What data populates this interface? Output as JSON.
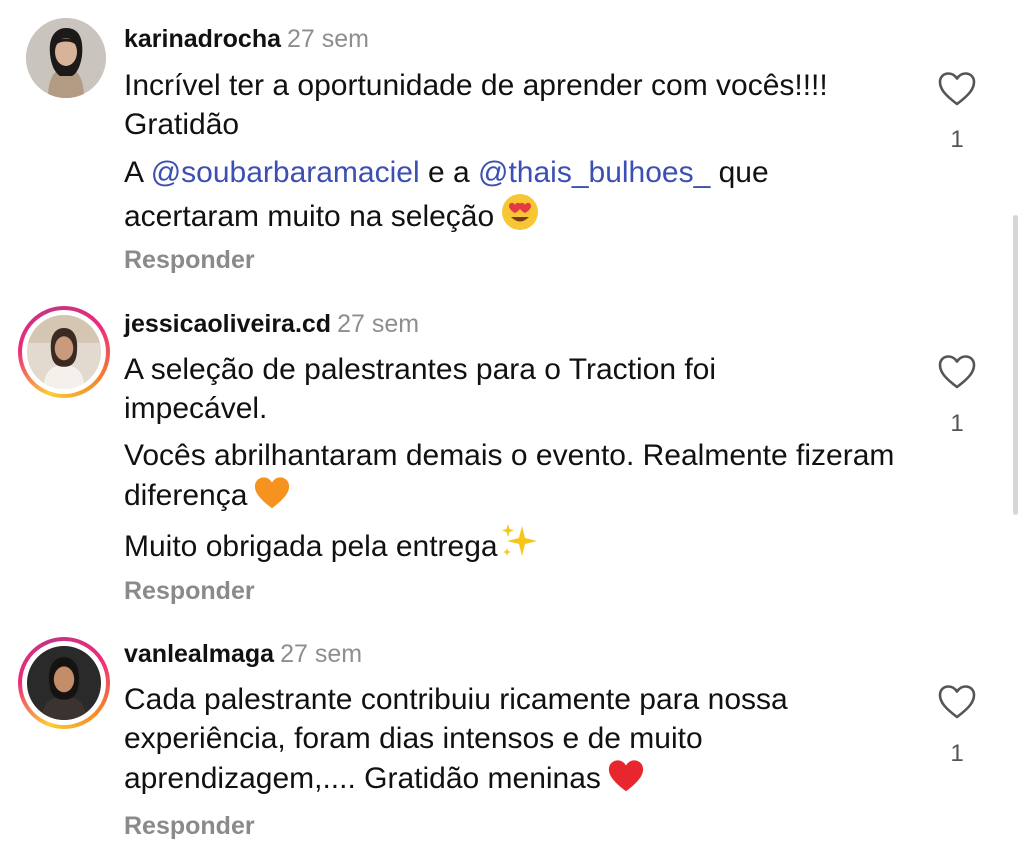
{
  "comments": [
    {
      "username": "karinadrocha",
      "time": "27 sem",
      "text": "Incrível ter a oportunidade de aprender com vocês!!!! Gratidão",
      "text2_pre": "A ",
      "mention1": "@soubarbaramaciel",
      "text2_mid": " e a ",
      "mention2": "@thais_bulhoes_",
      "text2_post": " que acertaram muito na seleção",
      "emoji": "heart-eyes",
      "like_count": "1",
      "reply_label": "Responder",
      "story_ring": false
    },
    {
      "username": "jessicaoliveira.cd",
      "time": "27 sem",
      "text": "A seleção de palestrantes para o Traction foi impecável.",
      "text2": "Vocês abrilhantaram demais o evento. Realmente fizeram diferença",
      "emoji2": "orange-heart",
      "text3": "Muito obrigada pela entrega",
      "emoji3": "sparkles",
      "like_count": "1",
      "reply_label": "Responder",
      "story_ring": true
    },
    {
      "username": "vanlealmaga",
      "time": "27 sem",
      "text": "Cada palestrante contribuiu ricamente para nossa experiência, foram dias intensos e de muito aprendizagem,.... Gratidão meninas",
      "emoji": "red-heart",
      "like_count": "1",
      "reply_label": "Responder",
      "story_ring": true
    }
  ],
  "icons": {
    "like": "heart-outline-icon"
  },
  "colors": {
    "mention": "#3c4fb2",
    "muted": "#8e8e8e",
    "text": "#111111"
  }
}
